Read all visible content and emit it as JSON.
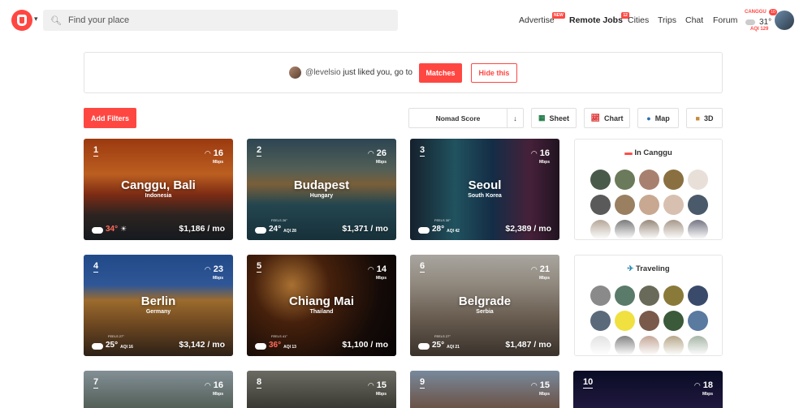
{
  "header": {
    "search_placeholder": "Find your place",
    "nav": [
      {
        "label": "Advertise",
        "badge": "NEW"
      },
      {
        "label": "Remote Jobs",
        "badge": "12"
      },
      {
        "label": "Cities"
      },
      {
        "label": "Trips"
      },
      {
        "label": "Chat"
      },
      {
        "label": "Forum"
      }
    ],
    "location": {
      "city": "CANGGU",
      "badge": "10",
      "temp": "31°",
      "aqi": "AQI 129"
    }
  },
  "notification": {
    "user": "@levelsio",
    "text": "just liked you, go to",
    "matches_label": "Matches",
    "hide_label": "Hide this"
  },
  "filters": {
    "add_label": "Add Filters",
    "sort_label": "Nomad Score",
    "sort_arrow": "↓",
    "tools": [
      {
        "label": "Sheet",
        "icon": "sheet-icon"
      },
      {
        "label": "Chart",
        "icon": "chart-icon"
      },
      {
        "label": "Map",
        "icon": "globe-icon"
      },
      {
        "label": "3D",
        "icon": "cube-icon"
      }
    ]
  },
  "cities": [
    {
      "rank": "1",
      "name": "Canggu, Bali",
      "country": "Indonesia",
      "wifi": "16",
      "wifi_unit": "Mbps",
      "price": "$1,186 / mo",
      "temp": "34°",
      "aqi": "",
      "feels": "",
      "hot": true
    },
    {
      "rank": "2",
      "name": "Budapest",
      "country": "Hungary",
      "wifi": "26",
      "wifi_unit": "Mbps",
      "price": "$1,371 / mo",
      "temp": "24°",
      "aqi": "AQI 28",
      "feels": "FEELS 26°"
    },
    {
      "rank": "3",
      "name": "Seoul",
      "country": "South Korea",
      "wifi": "16",
      "wifi_unit": "Mbps",
      "price": "$2,389 / mo",
      "temp": "28°",
      "aqi": "AQI 42",
      "feels": "FEELS 30°"
    },
    {
      "rank": "4",
      "name": "Berlin",
      "country": "Germany",
      "wifi": "23",
      "wifi_unit": "Mbps",
      "price": "$3,142 / mo",
      "temp": "25°",
      "aqi": "AQI 16",
      "feels": "FEELS 27°"
    },
    {
      "rank": "5",
      "name": "Chiang Mai",
      "country": "Thailand",
      "wifi": "14",
      "wifi_unit": "Mbps",
      "price": "$1,100 / mo",
      "temp": "36°",
      "aqi": "AQI 13",
      "feels": "FEELS 41°",
      "hot": true
    },
    {
      "rank": "6",
      "name": "Belgrade",
      "country": "Serbia",
      "wifi": "21",
      "wifi_unit": "Mbps",
      "price": "$1,487 / mo",
      "temp": "25°",
      "aqi": "AQI 21",
      "feels": "FEELS 27°"
    },
    {
      "rank": "7",
      "wifi": "16",
      "wifi_unit": "Mbps"
    },
    {
      "rank": "8",
      "wifi": "15",
      "wifi_unit": "Mbps"
    },
    {
      "rank": "9",
      "wifi": "15",
      "wifi_unit": "Mbps"
    },
    {
      "rank": "10",
      "wifi": "18",
      "wifi_unit": "Mbps"
    }
  ],
  "panels": [
    {
      "title": "In Canggu",
      "icon": "indonesia-flag-icon"
    },
    {
      "title": "Traveling",
      "icon": "airplane-icon"
    }
  ],
  "colors": {
    "accent": "#ff4742"
  }
}
